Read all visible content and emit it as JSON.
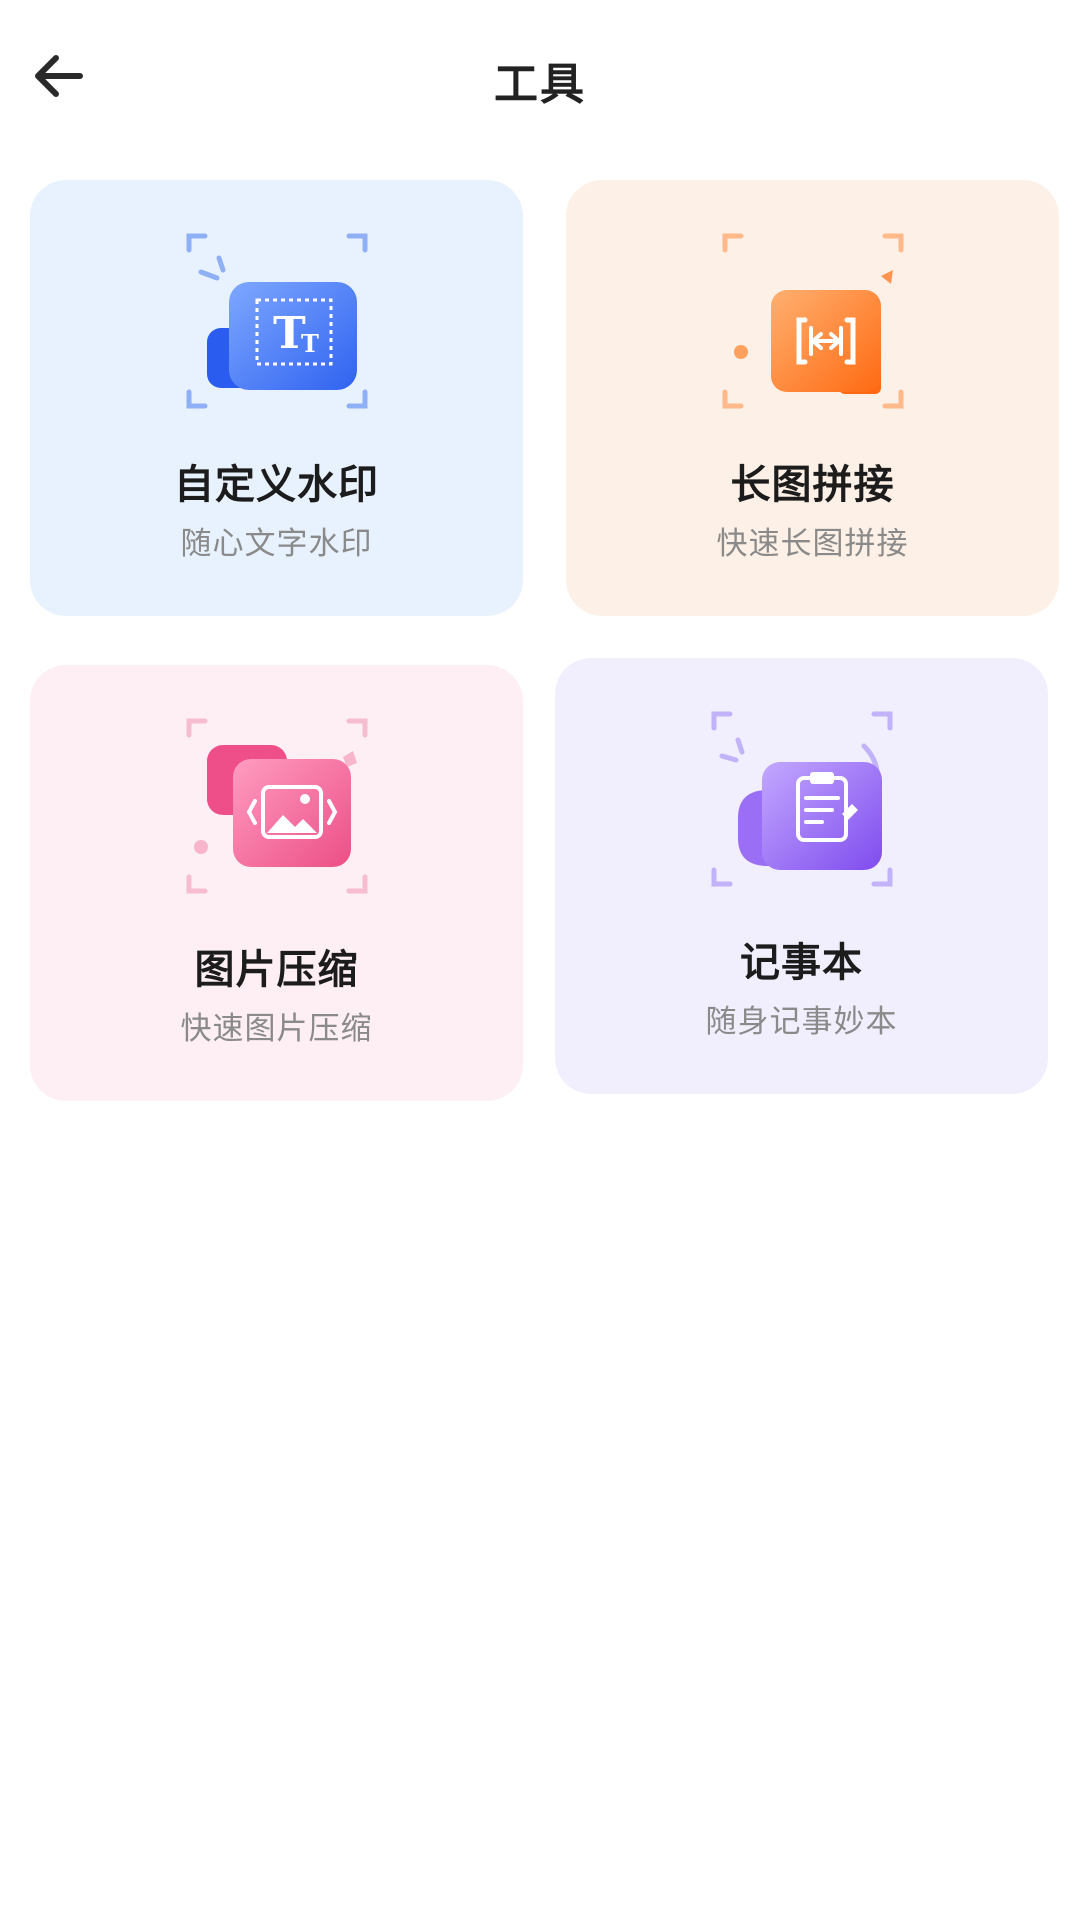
{
  "header": {
    "title": "工具",
    "back_icon": "arrow-left-icon"
  },
  "tools": [
    {
      "title": "自定义水印",
      "subtitle": "随心文字水印",
      "icon": "text-watermark-icon",
      "accent": "#3b6ef5",
      "background": "#e8f2fe"
    },
    {
      "title": "长图拼接",
      "subtitle": "快速长图拼接",
      "icon": "image-stitch-icon",
      "accent": "#ff7a1f",
      "background": "#fdf0e6"
    },
    {
      "title": "图片压缩",
      "subtitle": "快速图片压缩",
      "icon": "image-compress-icon",
      "accent": "#f0508a",
      "background": "#fdeff4"
    },
    {
      "title": "记事本",
      "subtitle": "随身记事妙本",
      "icon": "notepad-icon",
      "accent": "#8a5cf0",
      "background": "#f1eefe"
    }
  ]
}
